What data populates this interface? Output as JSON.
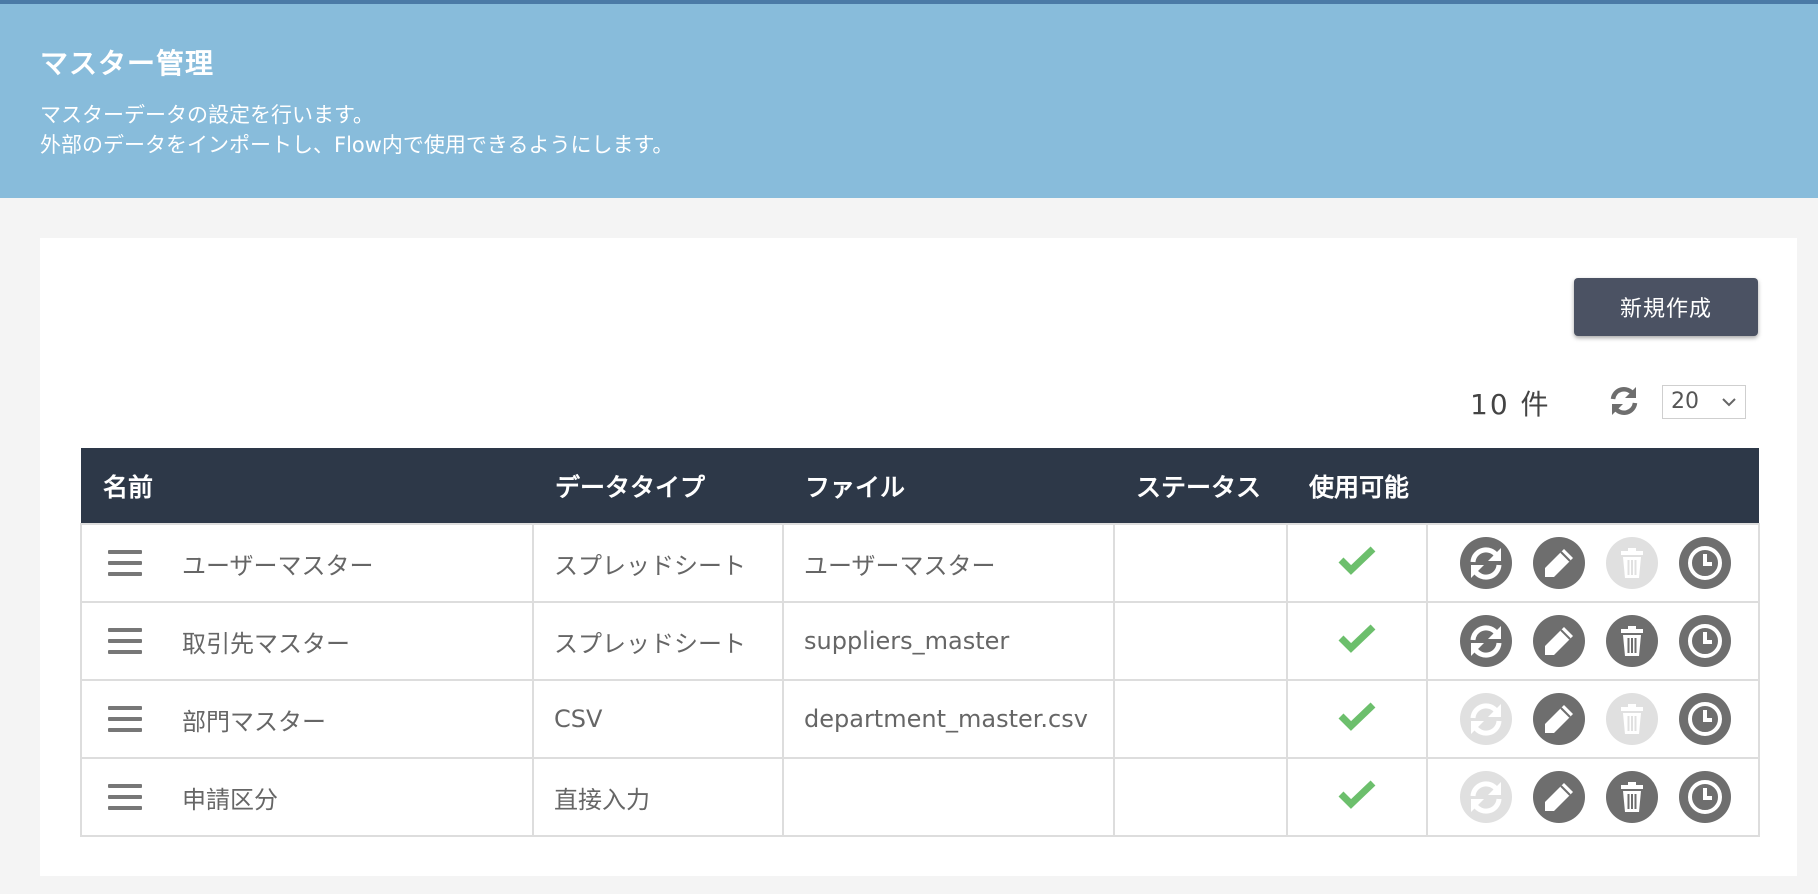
{
  "header": {
    "title": "マスター管理",
    "desc_line1": "マスターデータの設定を行います。",
    "desc_line2": "外部のデータをインポートし、Flow内で使用できるようにします。"
  },
  "toolbar": {
    "new_label": "新規作成",
    "count": "10 件",
    "page_size": "20",
    "refresh_icon": "refresh-icon"
  },
  "table": {
    "headers": {
      "name": "名前",
      "type": "データタイプ",
      "file": "ファイル",
      "status": "ステータス",
      "usable": "使用可能"
    },
    "rows": [
      {
        "name": "ユーザーマスター",
        "type": "スプレッドシート",
        "file": "ユーザーマスター",
        "status": "",
        "usable": true,
        "sync_enabled": true,
        "edit_enabled": true,
        "delete_enabled": false,
        "history_enabled": true
      },
      {
        "name": "取引先マスター",
        "type": "スプレッドシート",
        "file": "suppliers_master",
        "status": "",
        "usable": true,
        "sync_enabled": true,
        "edit_enabled": true,
        "delete_enabled": true,
        "history_enabled": true
      },
      {
        "name": "部門マスター",
        "type": "CSV",
        "file": "department_master.csv",
        "status": "",
        "usable": true,
        "sync_enabled": false,
        "edit_enabled": true,
        "delete_enabled": false,
        "history_enabled": true
      },
      {
        "name": "申請区分",
        "type": "直接入力",
        "file": "",
        "status": "",
        "usable": true,
        "sync_enabled": false,
        "edit_enabled": true,
        "delete_enabled": true,
        "history_enabled": true
      }
    ]
  },
  "colors": {
    "header_bg": "#88bcdb",
    "table_header_bg": "#2d3848",
    "button_bg": "#4b5263",
    "check": "#6cbf6c",
    "icon_active": "#6e6e6e",
    "icon_disabled": "#e0e0e0"
  }
}
